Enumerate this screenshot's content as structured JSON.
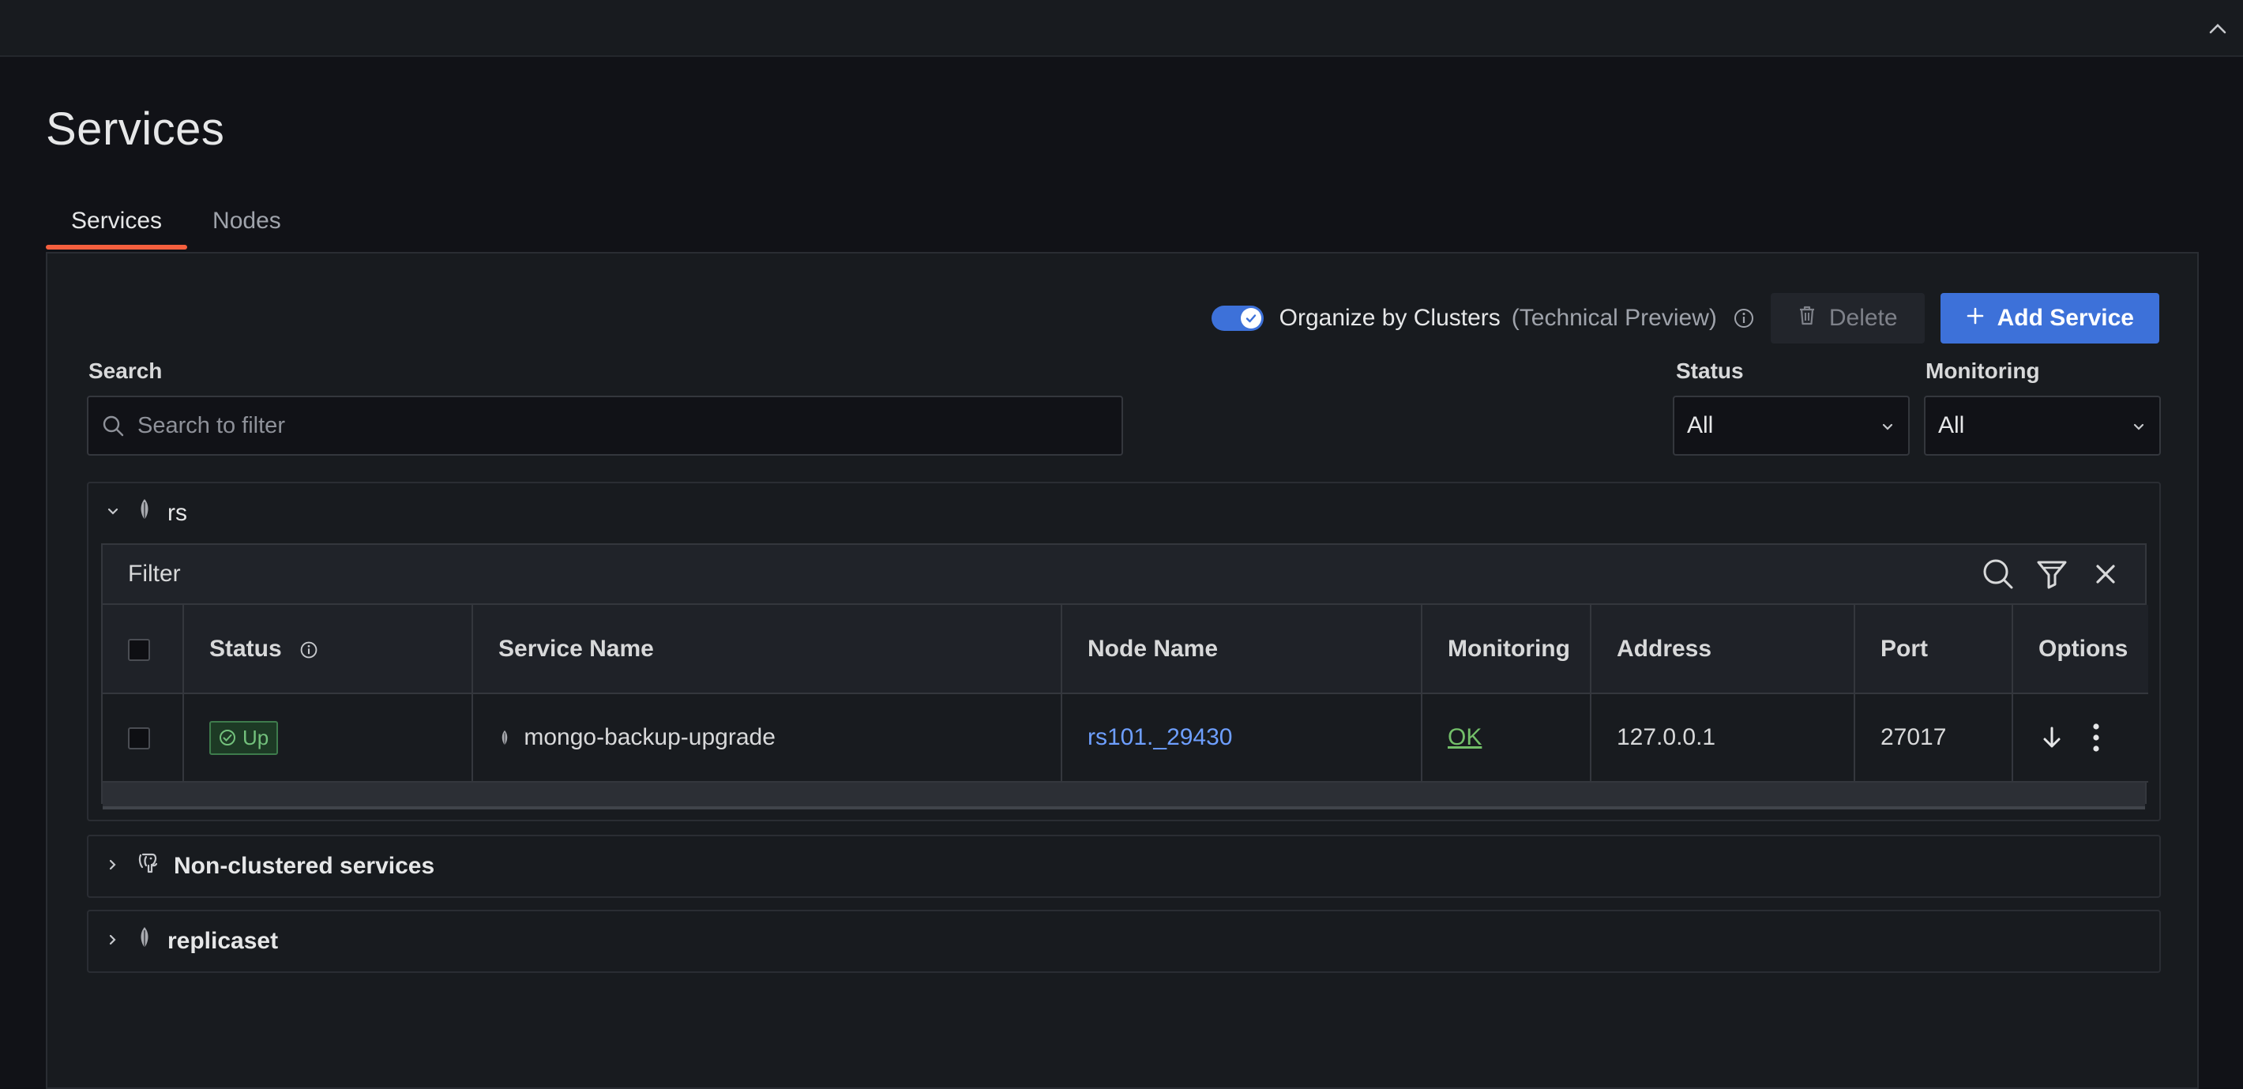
{
  "page": {
    "title": "Services"
  },
  "tabs": [
    {
      "label": "Services",
      "active": true
    },
    {
      "label": "Nodes",
      "active": false
    }
  ],
  "toolbar": {
    "organize_label": "Organize by Clusters",
    "organize_preview": "(Technical Preview)",
    "organize_enabled": true,
    "delete_label": "Delete",
    "add_label": "Add Service"
  },
  "filters": {
    "search_label": "Search",
    "search_placeholder": "Search to filter",
    "status_label": "Status",
    "status_value": "All",
    "monitoring_label": "Monitoring",
    "monitoring_value": "All"
  },
  "clusters": [
    {
      "name": "rs",
      "expanded": true,
      "icon": "mongodb-leaf-icon",
      "filter_label": "Filter",
      "columns": [
        "Status",
        "Service Name",
        "Node Name",
        "Monitoring",
        "Address",
        "Port",
        "Options"
      ],
      "rows": [
        {
          "status": "Up",
          "service_name": "mongo-backup-upgrade",
          "node_name": "rs101._29430",
          "monitoring": "OK",
          "address": "127.0.0.1",
          "port": "27017"
        }
      ]
    },
    {
      "name": "Non-clustered services",
      "expanded": false,
      "icon": "postgresql-elephant-icon"
    },
    {
      "name": "replicaset",
      "expanded": false,
      "icon": "mongodb-leaf-icon"
    }
  ],
  "colors": {
    "accent_blue": "#3d71d9",
    "tab_underline": "#f55f3e",
    "status_up": "#73c17c",
    "link": "#6e9fff",
    "ok_green": "#73bf69"
  }
}
